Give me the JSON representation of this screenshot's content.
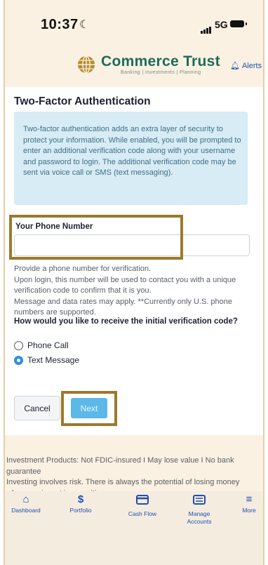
{
  "status_bar": {
    "time": "10:37",
    "network": "5G"
  },
  "brand": {
    "name": "Commerce Trust",
    "tagline": "Banking | Investments | Planning",
    "alerts_label": "Alerts"
  },
  "page": {
    "title": "Two-Factor Authentication",
    "info": "Two-factor authentication adds an extra layer of security to protect your information. While enabled, you will be prompted to enter an additional verification code along with your username and password to login. The additional verification code may be sent via voice call or SMS (text messaging).",
    "phone_label": "Your Phone Number",
    "phone_value": "",
    "help_1": "Provide a phone number for verification.",
    "help_2": "Upon login, this number will be used to contact you with a unique verification code to confirm that it is you.",
    "help_3": "Message and data rates may apply. **Currently only U.S. phone numbers are supported.",
    "question": "How would you like to receive the initial verification code?",
    "option_call": "Phone Call",
    "option_text": "Text Message",
    "selected_option": "Text Message",
    "cancel_label": "Cancel",
    "next_label": "Next"
  },
  "disclaimer": {
    "line1": "Investment Products: Not FDIC-insured I May lose value I No bank guarantee",
    "line2": "Investing involves risk. There is always the potential of losing money when you invest in securities."
  },
  "nav": [
    {
      "label": "Dashboard",
      "icon": "home-icon"
    },
    {
      "label": "Portfolio",
      "icon": "dollar-icon"
    },
    {
      "label": "Cash Flow",
      "icon": "card-icon"
    },
    {
      "label": "Manage Accounts",
      "icon": "accounts-icon"
    },
    {
      "label": "More",
      "icon": "menu-icon"
    }
  ],
  "colors": {
    "brand": "#1e6b5b",
    "accent": "#2f8fe0",
    "highlight": "#9b7a2c"
  }
}
